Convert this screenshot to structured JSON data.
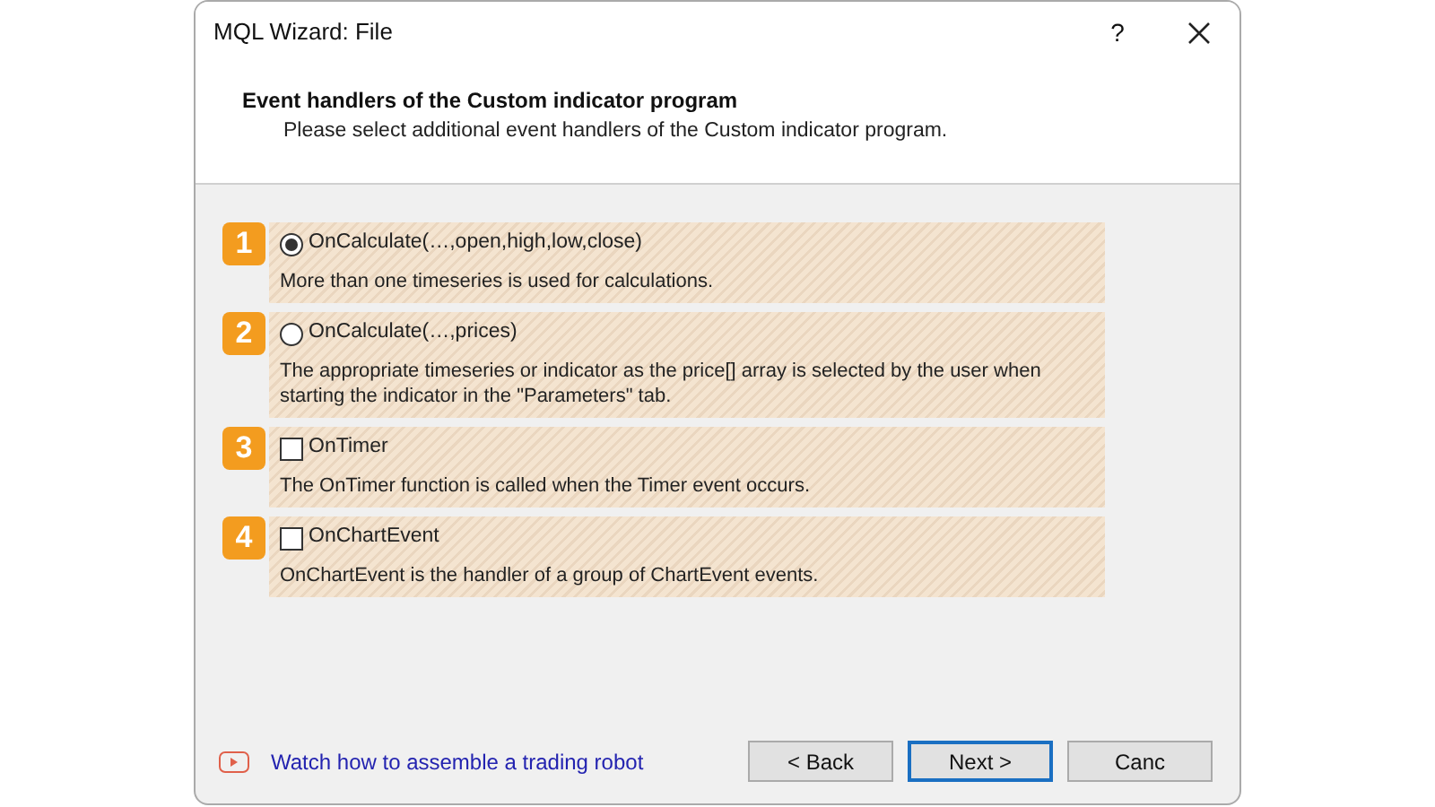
{
  "window": {
    "title": "MQL Wizard: File",
    "help": "?"
  },
  "header": {
    "title": "Event handlers of the Custom indicator program",
    "subtitle": "Please select additional event handlers of the Custom indicator program."
  },
  "options": [
    {
      "number": "1",
      "kind": "radio",
      "label": "OnCalculate(…,open,high,low,close)",
      "selected": true,
      "description": "More than one timeseries is used for calculations."
    },
    {
      "number": "2",
      "kind": "radio",
      "label": "OnCalculate(…,prices)",
      "selected": false,
      "description": "The appropriate timeseries or indicator as the price[] array is selected by the user when starting the indicator in the \"Parameters\" tab."
    },
    {
      "number": "3",
      "kind": "checkbox",
      "label": "OnTimer",
      "checked": false,
      "description": "The OnTimer function is called when the Timer event occurs."
    },
    {
      "number": "4",
      "kind": "checkbox",
      "label": "OnChartEvent",
      "checked": false,
      "description": "OnChartEvent is the handler of a group of ChartEvent events."
    }
  ],
  "footer": {
    "link": "Watch how to assemble a trading robot",
    "buttons": [
      {
        "label": "< Back",
        "default": false
      },
      {
        "label": "Next >",
        "default": true
      },
      {
        "label": "Canc",
        "default": false
      }
    ]
  }
}
